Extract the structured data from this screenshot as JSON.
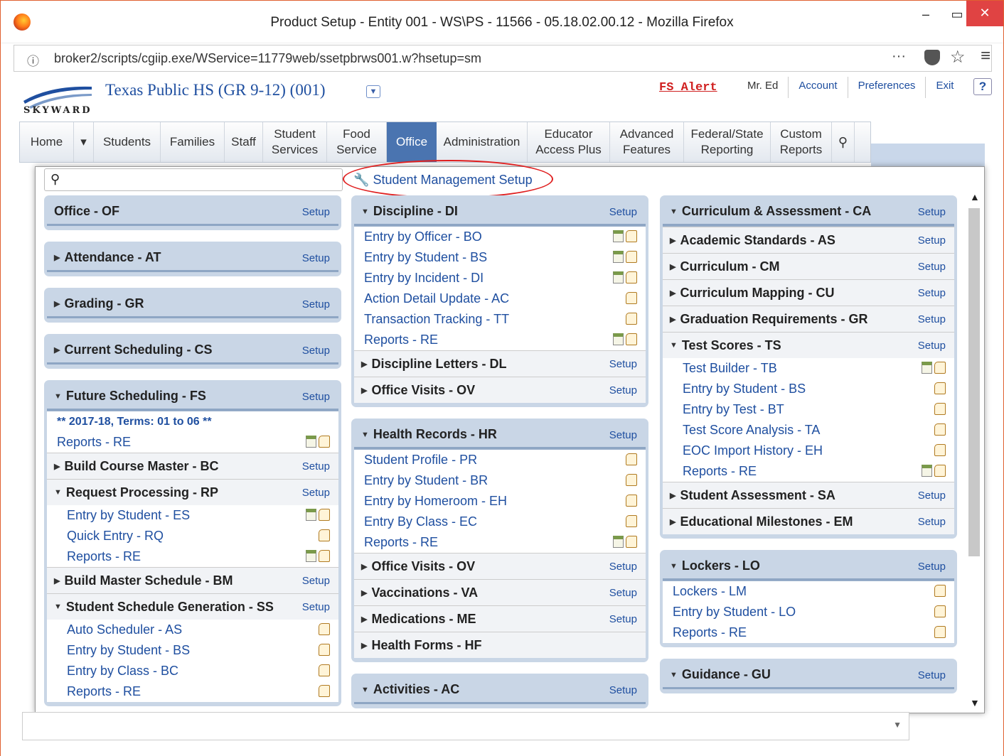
{
  "window": {
    "title": "Product Setup - Entity 001 - WS\\PS - 11566 - 05.18.02.00.12 - Mozilla Firefox",
    "min": "–",
    "max": "▭",
    "close": "✕"
  },
  "browser": {
    "url": "broker2/scripts/cgiip.exe/WService=11779web/ssetpbrws001.w?hsetup=sm",
    "dots": "···",
    "star": "☆",
    "menu": "≡",
    "info": "ⓘ"
  },
  "header": {
    "logo_text": "SKYWARD",
    "district": "Texas Public HS (GR 9-12) (001)",
    "fs_alert": "FS Alert",
    "user": "Mr. Ed",
    "links": [
      "Account",
      "Preferences",
      "Exit"
    ],
    "help": "?"
  },
  "nav": {
    "tabs": [
      "Home",
      "▾",
      "Students",
      "Families",
      "Staff",
      "Student Services",
      "Food Service",
      "Office",
      "Administration",
      "Educator Access Plus",
      "Advanced Features",
      "Federal/State Reporting",
      "Custom Reports"
    ],
    "active": "Office"
  },
  "search": {
    "placeholder": "",
    "value": ""
  },
  "setup_link": "Student Management Setup",
  "setup_label": "Setup",
  "col1": {
    "office": "Office - OF",
    "attendance": "Attendance - AT",
    "grading": "Grading - GR",
    "current_sched": "Current Scheduling - CS",
    "future_sched": "Future Scheduling - FS",
    "terms_note": "** 2017-18, Terms: 01 to 06 **",
    "fs_reports": "Reports - RE",
    "build_course": "Build Course Master - BC",
    "request_processing": "Request Processing - RP",
    "rp_items": [
      "Entry by Student - ES",
      "Quick Entry - RQ",
      "Reports - RE"
    ],
    "build_master": "Build Master Schedule - BM",
    "ssg": "Student Schedule Generation - SS",
    "ssg_items": [
      "Auto Scheduler - AS",
      "Entry by Student - BS",
      "Entry by Class - BC",
      "Reports - RE"
    ]
  },
  "col2": {
    "discipline": "Discipline - DI",
    "di_items": [
      "Entry by Officer - BO",
      "Entry by Student - BS",
      "Entry by Incident - DI",
      "Action Detail Update - AC",
      "Transaction Tracking - TT",
      "Reports - RE"
    ],
    "discipline_letters": "Discipline Letters - DL",
    "office_visits": "Office Visits - OV",
    "health": "Health Records - HR",
    "hr_items": [
      "Student Profile - PR",
      "Entry by Student - BR",
      "Entry by Homeroom - EH",
      "Entry By Class - EC",
      "Reports - RE"
    ],
    "hr_office_visits": "Office Visits - OV",
    "vaccinations": "Vaccinations - VA",
    "medications": "Medications - ME",
    "health_forms": "Health Forms - HF",
    "activities": "Activities - AC"
  },
  "col3": {
    "curriculum": "Curriculum & Assessment - CA",
    "academic": "Academic Standards - AS",
    "curric": "Curriculum - CM",
    "mapping": "Curriculum Mapping - CU",
    "grad": "Graduation Requirements - GR",
    "test_scores": "Test Scores - TS",
    "ts_items": [
      "Test Builder - TB",
      "Entry by Student - BS",
      "Entry by Test - BT",
      "Test Score Analysis - TA",
      "EOC Import History - EH",
      "Reports - RE"
    ],
    "student_assessment": "Student Assessment - SA",
    "milestones": "Educational Milestones - EM",
    "lockers": "Lockers - LO",
    "lo_items": [
      "Lockers - LM",
      "Entry by Student - LO",
      "Reports - RE"
    ],
    "guidance": "Guidance - GU"
  }
}
